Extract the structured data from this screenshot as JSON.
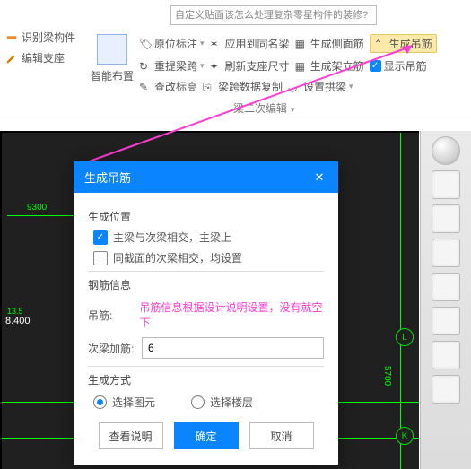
{
  "top_hint": "自定义贴面该怎么处理复杂零星构件的装修?",
  "toolbar": {
    "identify_beam": "识别梁构件",
    "edit_support": "编辑支座",
    "smart_layout": "智能布置"
  },
  "ribbon": {
    "r1": {
      "a": "原位标注",
      "b": "应用到同名梁",
      "c": "生成侧面筋",
      "d": "生成吊筋"
    },
    "r2": {
      "a": "重提梁跨",
      "b": "刷新支座尺寸",
      "c": "生成架立筋",
      "d": "显示吊筋"
    },
    "r3": {
      "a": "查改标高",
      "b": "梁跨数据复制",
      "c": "设置拱梁"
    },
    "group": "梁二次编辑"
  },
  "canvas": {
    "dim1": "9300",
    "coord": "8.400",
    "elev": "13.5"
  },
  "dialog": {
    "title": "生成吊筋",
    "sect_pos": "生成位置",
    "opt1": "主梁与次梁相交，主梁上",
    "opt2": "同截面的次梁相交，均设置",
    "sect_rebar": "钢筋信息",
    "lab_diaojin": "吊筋:",
    "note": "吊筋信息根据设计说明设置，没有就空下",
    "lab_ciliang": "次梁加筋:",
    "val_ciliang": "6",
    "sect_mode": "生成方式",
    "radio1": "选择图元",
    "radio2": "选择楼层",
    "btn_help": "查看说明",
    "btn_ok": "确定",
    "btn_cancel": "取消"
  },
  "labels": {
    "L": "L",
    "K": "K",
    "v": "5700"
  }
}
